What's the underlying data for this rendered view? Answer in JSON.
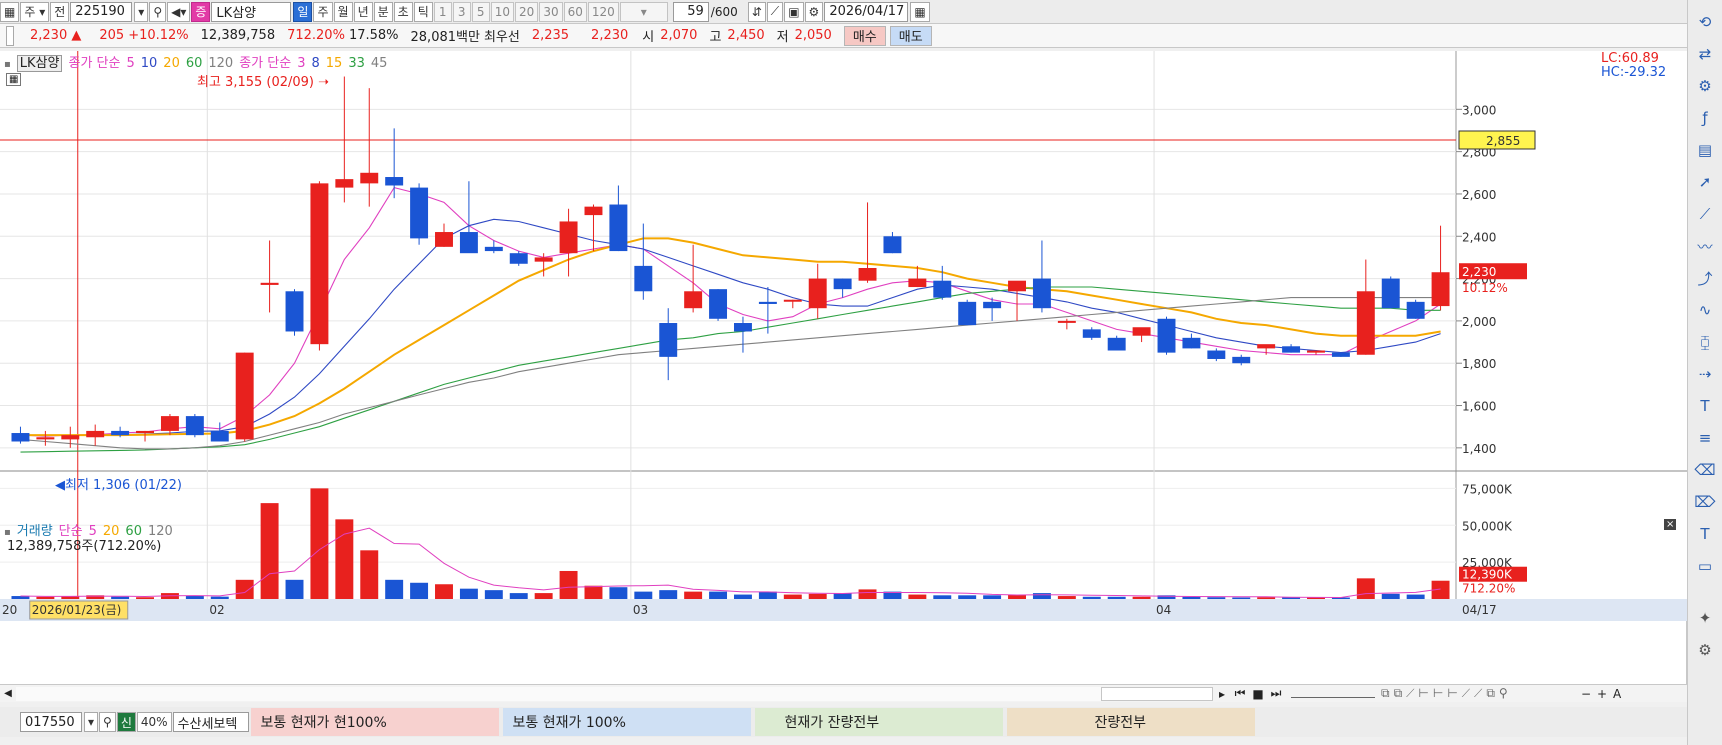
{
  "toolbar": {
    "type_label": "주",
    "prev_label": "전",
    "code": "225190",
    "stock_badge": "증",
    "stock_name": "LK삼양",
    "periods": [
      "일",
      "주",
      "월",
      "년",
      "분",
      "초",
      "틱"
    ],
    "active_period": "일",
    "minute_steps": [
      "1",
      "3",
      "5",
      "10",
      "20",
      "30",
      "60",
      "120"
    ],
    "count_value": "59",
    "count_total": "/600",
    "date": "2026/04/17"
  },
  "quote": {
    "price": "2,230 ▲",
    "change": "205",
    "change_pct": "+10.12%",
    "volume": "12,389,758",
    "volume_ratio": "712.20%",
    "turnover": "17.58%",
    "amount": "28,081백만",
    "best_label": "최우선",
    "best_ask": "2,235",
    "best_bid": "2,230",
    "open_label": "시",
    "open": "2,070",
    "high_label": "고",
    "high": "2,450",
    "low_label": "저",
    "low": "2,050",
    "buy_label": "매수",
    "sell_label": "매도"
  },
  "price_panel": {
    "stock_tag": "LK삼양",
    "ma1_label": "종가 단순",
    "ma1_periods": [
      "5",
      "10",
      "20",
      "60",
      "120"
    ],
    "ma2_label": "종가 단순",
    "ma2_periods": [
      "3",
      "8",
      "15",
      "33",
      "45"
    ],
    "high_note": "최고 3,155 (02/09)",
    "low_note": "최저 1,306 (01/22)",
    "lc_label": "LC:60.89",
    "hc_label": "HC:-29.32",
    "y_ticks": [
      "3,000",
      "2,800",
      "2,600",
      "2,400",
      "2,200",
      "2,000",
      "1,800",
      "1,600",
      "1,400"
    ],
    "crosshair_price": "2,855",
    "last_price": "2,230",
    "last_pct": "10.12%"
  },
  "volume_panel": {
    "legend_label": "거래량",
    "ma_label": "단순",
    "ma_periods": [
      "5",
      "20",
      "60",
      "120"
    ],
    "value_note": "12,389,758주(712.20%)",
    "y_ticks": [
      "75,000K",
      "50,000K",
      "25,000K"
    ],
    "last_volume": "12,390K",
    "last_pct": "712.20%"
  },
  "x_axis": {
    "labels": [
      "02",
      "03",
      "04"
    ],
    "start_label": "20",
    "crosshair_date": "2026/01/23(금)",
    "end_label": "04/17"
  },
  "bottom": {
    "account": "017550",
    "credit_label": "신",
    "pct_label": "40%",
    "strategy": "수산세보텍",
    "seg1": "보통   현재가   현100%",
    "seg2": "보통   현재가     100%",
    "seg3": "현재가     잔량전부",
    "seg4": "잔량전부"
  },
  "colors": {
    "up": "#e8211e",
    "down": "#1a55d4",
    "ma_short": "#e040c0",
    "ma_mid": "#2f49c4",
    "ma_gold": "#f5a800",
    "ma_green": "#2ea043",
    "ma_gray": "#808080"
  },
  "chart_data": {
    "type": "candlestick",
    "candles": [
      {
        "o": 1470,
        "h": 1500,
        "l": 1420,
        "c": 1430
      },
      {
        "o": 1440,
        "h": 1480,
        "l": 1410,
        "c": 1450
      },
      {
        "o": 1440,
        "h": 1500,
        "l": 1400,
        "c": 1460
      },
      {
        "o": 1450,
        "h": 1510,
        "l": 1410,
        "c": 1480
      },
      {
        "o": 1480,
        "h": 1500,
        "l": 1450,
        "c": 1460
      },
      {
        "o": 1470,
        "h": 1480,
        "l": 1430,
        "c": 1480
      },
      {
        "o": 1480,
        "h": 1560,
        "l": 1460,
        "c": 1550
      },
      {
        "o": 1550,
        "h": 1560,
        "l": 1450,
        "c": 1460
      },
      {
        "o": 1480,
        "h": 1520,
        "l": 1430,
        "c": 1430
      },
      {
        "o": 1440,
        "h": 1850,
        "l": 1430,
        "c": 1850
      },
      {
        "o": 2170,
        "h": 2380,
        "l": 2040,
        "c": 2180
      },
      {
        "o": 2140,
        "h": 2150,
        "l": 1930,
        "c": 1950
      },
      {
        "o": 1890,
        "h": 2660,
        "l": 1860,
        "c": 2650
      },
      {
        "o": 2630,
        "h": 3155,
        "l": 2560,
        "c": 2670
      },
      {
        "o": 2650,
        "h": 3100,
        "l": 2540,
        "c": 2700
      },
      {
        "o": 2680,
        "h": 2910,
        "l": 2580,
        "c": 2640
      },
      {
        "o": 2630,
        "h": 2650,
        "l": 2360,
        "c": 2390
      },
      {
        "o": 2350,
        "h": 2460,
        "l": 2350,
        "c": 2420
      },
      {
        "o": 2420,
        "h": 2660,
        "l": 2340,
        "c": 2320
      },
      {
        "o": 2350,
        "h": 2380,
        "l": 2320,
        "c": 2330
      },
      {
        "o": 2320,
        "h": 2330,
        "l": 2260,
        "c": 2270
      },
      {
        "o": 2280,
        "h": 2320,
        "l": 2210,
        "c": 2300
      },
      {
        "o": 2320,
        "h": 2530,
        "l": 2210,
        "c": 2470
      },
      {
        "o": 2500,
        "h": 2550,
        "l": 2330,
        "c": 2540
      },
      {
        "o": 2550,
        "h": 2640,
        "l": 2330,
        "c": 2330
      },
      {
        "o": 2260,
        "h": 2460,
        "l": 2100,
        "c": 2140
      },
      {
        "o": 1990,
        "h": 2060,
        "l": 1720,
        "c": 1830
      },
      {
        "o": 2060,
        "h": 2360,
        "l": 2040,
        "c": 2140
      },
      {
        "o": 2150,
        "h": 2150,
        "l": 2000,
        "c": 2010
      },
      {
        "o": 1990,
        "h": 2020,
        "l": 1850,
        "c": 1950
      },
      {
        "o": 2090,
        "h": 2160,
        "l": 1940,
        "c": 2080
      },
      {
        "o": 2100,
        "h": 2100,
        "l": 2060,
        "c": 2100
      },
      {
        "o": 2060,
        "h": 2270,
        "l": 2010,
        "c": 2200
      },
      {
        "o": 2200,
        "h": 2200,
        "l": 2110,
        "c": 2150
      },
      {
        "o": 2190,
        "h": 2560,
        "l": 2180,
        "c": 2250
      },
      {
        "o": 2400,
        "h": 2420,
        "l": 2320,
        "c": 2320
      },
      {
        "o": 2160,
        "h": 2260,
        "l": 2160,
        "c": 2200
      },
      {
        "o": 2190,
        "h": 2260,
        "l": 2100,
        "c": 2110
      },
      {
        "o": 2090,
        "h": 2100,
        "l": 1980,
        "c": 1980
      },
      {
        "o": 2090,
        "h": 2110,
        "l": 2000,
        "c": 2060
      },
      {
        "o": 2140,
        "h": 2160,
        "l": 2000,
        "c": 2190
      },
      {
        "o": 2200,
        "h": 2380,
        "l": 2040,
        "c": 2060
      },
      {
        "o": 2000,
        "h": 2010,
        "l": 1960,
        "c": 2000
      },
      {
        "o": 1960,
        "h": 1970,
        "l": 1910,
        "c": 1920
      },
      {
        "o": 1920,
        "h": 1930,
        "l": 1870,
        "c": 1860
      },
      {
        "o": 1930,
        "h": 1960,
        "l": 1900,
        "c": 1970
      },
      {
        "o": 2010,
        "h": 2020,
        "l": 1840,
        "c": 1850
      },
      {
        "o": 1920,
        "h": 1940,
        "l": 1870,
        "c": 1870
      },
      {
        "o": 1860,
        "h": 1870,
        "l": 1810,
        "c": 1820
      },
      {
        "o": 1830,
        "h": 1840,
        "l": 1790,
        "c": 1800
      },
      {
        "o": 1870,
        "h": 1880,
        "l": 1840,
        "c": 1890
      },
      {
        "o": 1880,
        "h": 1890,
        "l": 1850,
        "c": 1850
      },
      {
        "o": 1850,
        "h": 1860,
        "l": 1840,
        "c": 1860
      },
      {
        "o": 1850,
        "h": 1850,
        "l": 1830,
        "c": 1830
      },
      {
        "o": 1840,
        "h": 2290,
        "l": 1840,
        "c": 2140
      },
      {
        "o": 2200,
        "h": 2210,
        "l": 2060,
        "c": 2060
      },
      {
        "o": 2090,
        "h": 2100,
        "l": 2010,
        "c": 2010
      },
      {
        "o": 2070,
        "h": 2450,
        "l": 2050,
        "c": 2230
      }
    ],
    "volumes": [
      2000,
      1500,
      1800,
      2500,
      1600,
      1200,
      4000,
      2200,
      1600,
      13000,
      65000,
      13000,
      75000,
      54000,
      33000,
      13000,
      11000,
      10000,
      7000,
      6000,
      4000,
      4000,
      19000,
      9000,
      8000,
      5000,
      6000,
      5000,
      5000,
      3000,
      5000,
      3000,
      3500,
      4000,
      6500,
      5000,
      3000,
      2500,
      2500,
      2500,
      3000,
      4000,
      2000,
      1500,
      1500,
      1500,
      2500,
      1500,
      1200,
      1000,
      1200,
      1000,
      1000,
      1000,
      14000,
      3500,
      3000,
      12390
    ],
    "ma_lines": [
      {
        "name": "5",
        "color": "#e040c0",
        "values": [
          1460,
          1455,
          1460,
          1462,
          1470,
          1475,
          1490,
          1500,
          1490,
          1550,
          1650,
          1800,
          2040,
          2290,
          2440,
          2630,
          2600,
          2560,
          2450,
          2380,
          2330,
          2300,
          2320,
          2340,
          2360,
          2340,
          2260,
          2180,
          2080,
          2030,
          2000,
          2020,
          2080,
          2110,
          2150,
          2180,
          2190,
          2180,
          2140,
          2100,
          2080,
          2080,
          2040,
          2000,
          1960,
          1940,
          1920,
          1900,
          1880,
          1860,
          1850,
          1840,
          1840,
          1840,
          1900,
          1950,
          2000,
          2080
        ]
      },
      {
        "name": "10",
        "color": "#2f49c4",
        "values": [
          1460,
          1458,
          1460,
          1460,
          1462,
          1465,
          1470,
          1478,
          1480,
          1500,
          1560,
          1640,
          1750,
          1880,
          2010,
          2150,
          2270,
          2390,
          2450,
          2480,
          2470,
          2440,
          2410,
          2380,
          2360,
          2340,
          2300,
          2260,
          2220,
          2180,
          2150,
          2110,
          2080,
          2070,
          2070,
          2110,
          2150,
          2170,
          2160,
          2150,
          2130,
          2110,
          2090,
          2060,
          2040,
          2010,
          1980,
          1950,
          1920,
          1900,
          1880,
          1870,
          1860,
          1850,
          1860,
          1880,
          1900,
          1940
        ]
      },
      {
        "name": "20",
        "color": "#f5a800",
        "values": [
          1460,
          1460,
          1460,
          1460,
          1460,
          1462,
          1464,
          1466,
          1468,
          1480,
          1510,
          1550,
          1610,
          1680,
          1760,
          1840,
          1910,
          1980,
          2050,
          2120,
          2190,
          2240,
          2290,
          2330,
          2360,
          2390,
          2390,
          2370,
          2340,
          2310,
          2300,
          2290,
          2280,
          2280,
          2270,
          2260,
          2250,
          2230,
          2200,
          2180,
          2160,
          2150,
          2140,
          2120,
          2100,
          2080,
          2060,
          2040,
          2010,
          1990,
          1980,
          1960,
          1940,
          1930,
          1930,
          1930,
          1930,
          1950
        ]
      },
      {
        "name": "60",
        "color": "#2ea043",
        "values": [
          1380,
          1382,
          1384,
          1386,
          1388,
          1390,
          1395,
          1400,
          1405,
          1415,
          1440,
          1470,
          1500,
          1540,
          1580,
          1620,
          1660,
          1700,
          1730,
          1760,
          1790,
          1810,
          1830,
          1850,
          1870,
          1890,
          1910,
          1920,
          1940,
          1950,
          1970,
          1990,
          2010,
          2030,
          2050,
          2070,
          2090,
          2110,
          2130,
          2140,
          2150,
          2160,
          2160,
          2160,
          2150,
          2140,
          2130,
          2120,
          2110,
          2100,
          2090,
          2080,
          2070,
          2060,
          2060,
          2060,
          2050,
          2050
        ]
      },
      {
        "name": "120",
        "color": "#808080",
        "values": [
          1440,
          1430,
          1420,
          1410,
          1400,
          1395,
          1395,
          1400,
          1410,
          1430,
          1460,
          1490,
          1520,
          1560,
          1590,
          1620,
          1650,
          1680,
          1710,
          1730,
          1760,
          1780,
          1800,
          1820,
          1840,
          1850,
          1860,
          1870,
          1880,
          1890,
          1900,
          1910,
          1920,
          1930,
          1940,
          1950,
          1960,
          1970,
          1980,
          1990,
          2000,
          2010,
          2020,
          2030,
          2040,
          2050,
          2060,
          2070,
          2080,
          2090,
          2100,
          2110,
          2110,
          2110,
          2110,
          2110,
          2110,
          2110
        ]
      }
    ]
  }
}
